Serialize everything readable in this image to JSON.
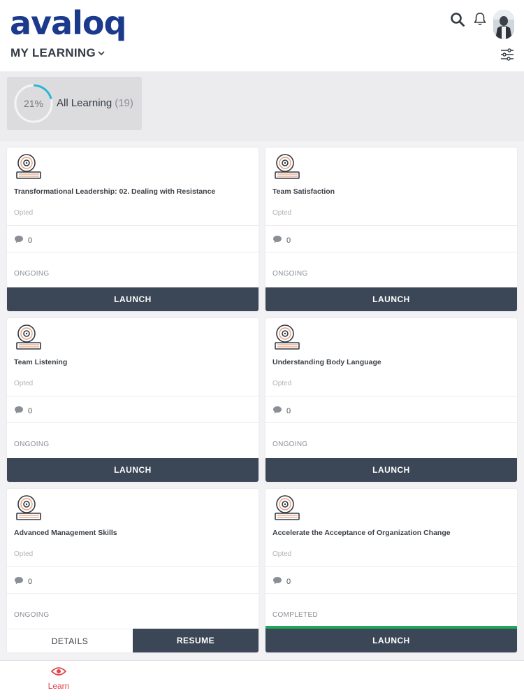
{
  "header": {
    "logo": "avaloq",
    "section_title": "MY LEARNING"
  },
  "summary": {
    "percent_text": "21%",
    "percent_value": 21,
    "label": "All Learning",
    "count": "(19)"
  },
  "cards": [
    {
      "title": "Transformational Leadership: 02. Dealing with Resistance",
      "opted": "Opted",
      "comments": "0",
      "status": "ONGOING",
      "action": "LAUNCH"
    },
    {
      "title": "Team Satisfaction",
      "opted": "Opted",
      "comments": "0",
      "status": "ONGOING",
      "action": "LAUNCH"
    },
    {
      "title": "Team Listening",
      "opted": "Opted",
      "comments": "0",
      "status": "ONGOING",
      "action": "LAUNCH"
    },
    {
      "title": "Understanding Body Language",
      "opted": "Opted",
      "comments": "0",
      "status": "ONGOING",
      "action": "LAUNCH"
    },
    {
      "title": "Advanced Management Skills",
      "opted": "Opted",
      "comments": "0",
      "status": "ONGOING",
      "details": "DETAILS",
      "action": "RESUME"
    },
    {
      "title": "Accelerate the Acceptance of Organization Change",
      "opted": "Opted",
      "comments": "0",
      "status": "COMPLETED",
      "progress": 1.0,
      "action": "LAUNCH"
    }
  ],
  "bottom_nav": {
    "learn_label": "Learn"
  },
  "colors": {
    "brand": "#1b3a8c",
    "button_dark": "#3b4656",
    "ring_accent": "#29b6d6",
    "completed_bar": "#1faa5b",
    "nav_active": "#e0474c"
  },
  "icons": [
    "search-icon",
    "bell-icon",
    "chevron-down-icon",
    "filter-sliders-icon",
    "course-disc-book-icon",
    "comment-bubble-icon",
    "eye-icon"
  ]
}
